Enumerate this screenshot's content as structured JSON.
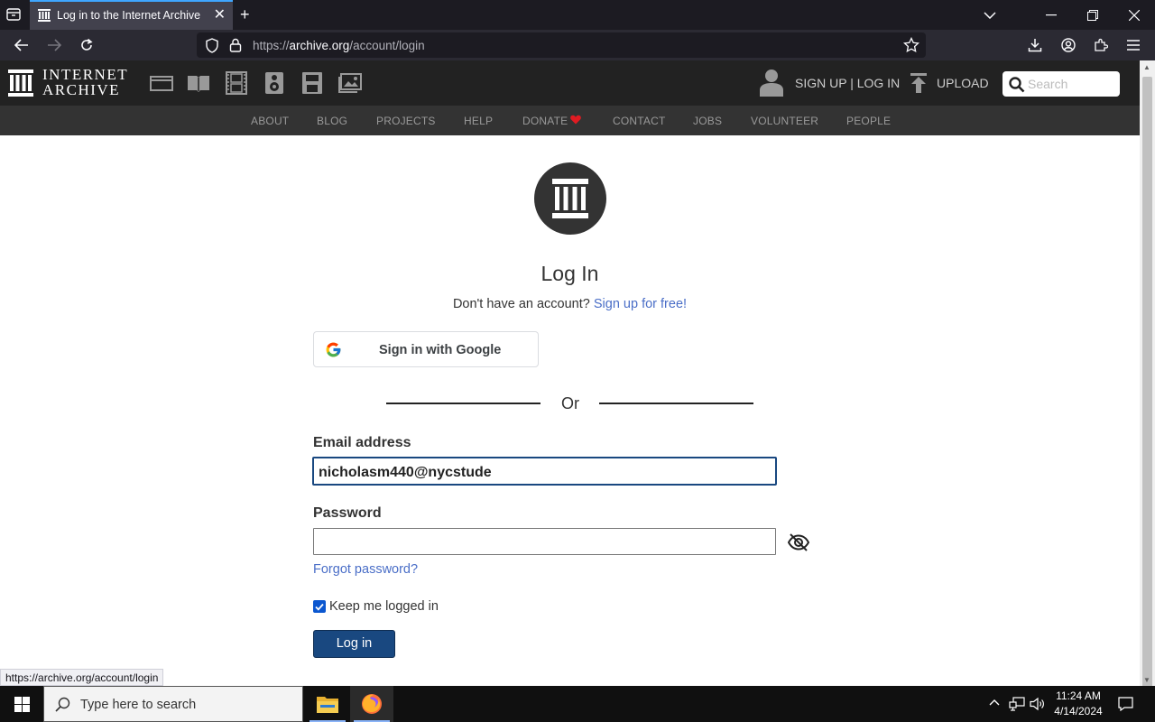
{
  "browser": {
    "tab_title": "Log in to the Internet Archive",
    "url_prefix": "https://",
    "url_host": "archive.org",
    "url_path": "/account/login"
  },
  "ia_header": {
    "logo_line1": "INTERNET",
    "logo_line2": "ARCHIVE",
    "account_links": "SIGN UP | LOG IN",
    "upload_label": "UPLOAD",
    "search_placeholder": "Search",
    "media_icons": [
      "web-icon",
      "texts-icon",
      "video-icon",
      "audio-icon",
      "software-icon",
      "images-icon"
    ]
  },
  "ia_nav": {
    "items": [
      "ABOUT",
      "BLOG",
      "PROJECTS",
      "HELP",
      "DONATE",
      "CONTACT",
      "JOBS",
      "VOLUNTEER",
      "PEOPLE"
    ],
    "donate_heart_color": "#e01b22"
  },
  "login": {
    "heading": "Log In",
    "no_account_text": "Don't have an account?",
    "signup_link": "Sign up for free!",
    "google_button": "Sign in with Google",
    "or_text": "Or",
    "email_label": "Email address",
    "email_value": "nicholasm440@nycstude",
    "password_label": "Password",
    "password_value": "",
    "forgot_link": "Forgot password?",
    "keep_logged_in_label": "Keep me logged in",
    "keep_logged_in_checked": true,
    "login_button": "Log in"
  },
  "status_bar": {
    "link_preview": "https://archive.org/account/login"
  },
  "taskbar": {
    "search_placeholder": "Type here to search",
    "time": "11:24 AM",
    "date": "4/14/2024"
  },
  "colors": {
    "primary_button": "#194880",
    "link": "#4a6ec7",
    "header_bg": "#222222",
    "nav_bg": "#333333"
  }
}
